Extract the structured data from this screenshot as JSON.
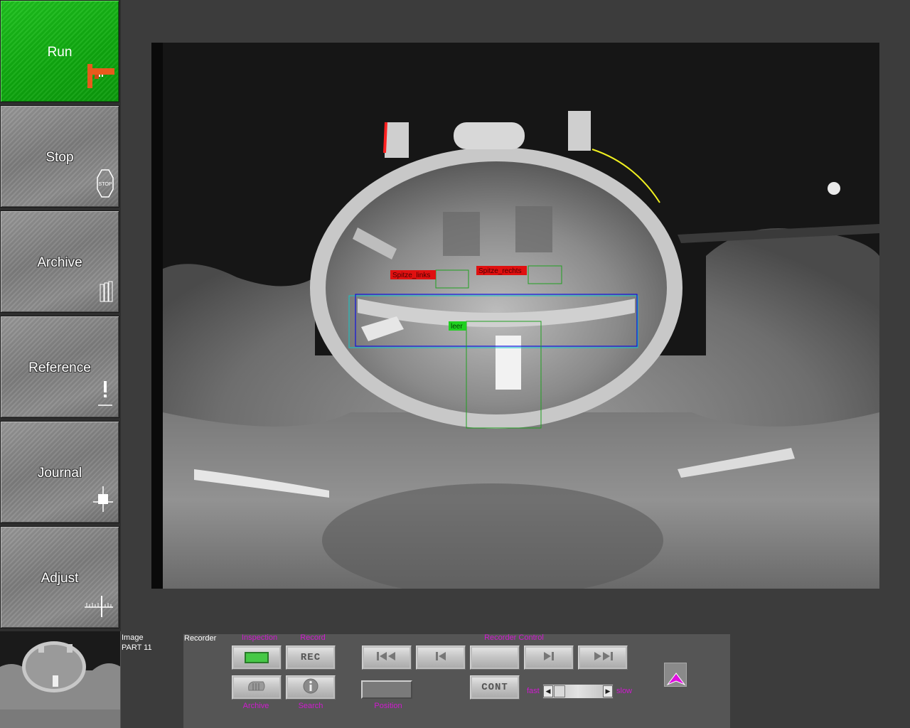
{
  "nav": {
    "run": "Run",
    "stop": "Stop",
    "archive": "Archive",
    "reference": "Reference",
    "journal": "Journal",
    "adjust": "Adjust"
  },
  "camera": {
    "rois": [
      {
        "label": "Spitze_links",
        "status": "fail"
      },
      {
        "label": "Spitze_rechts",
        "status": "fail"
      },
      {
        "label": "leer",
        "status": "ok"
      }
    ]
  },
  "image_info": {
    "title": "Image",
    "part": "PART  11"
  },
  "recorder": {
    "title": "Recorder",
    "inspection_label": "Inspection",
    "record_label": "Record",
    "recorder_control_label": "Recorder Control",
    "archive_label": "Archive",
    "search_label": "Search",
    "position_label": "Position",
    "rec_button": "REC",
    "cont_button": "CONT",
    "fast_label": "fast",
    "slow_label": "slow"
  },
  "colors": {
    "run_active": "#10b010",
    "roi_fail": "#e01010",
    "roi_ok": "#20c020",
    "label_magenta": "#d01ad0"
  }
}
